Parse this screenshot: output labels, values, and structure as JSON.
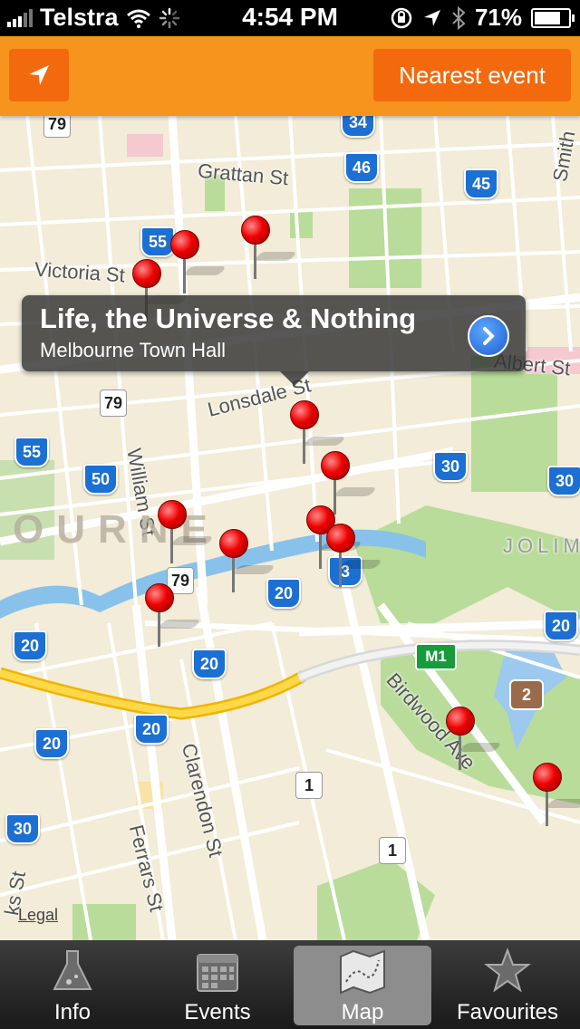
{
  "status_bar": {
    "carrier": "Telstra",
    "time": "4:54 PM",
    "battery_percent": "71%",
    "battery_level": 0.71
  },
  "toolbar": {
    "locate_icon": "location-arrow-icon",
    "nearest_label": "Nearest event"
  },
  "map": {
    "streets": [
      "Grattan St",
      "Victoria St",
      "Lonsdale St",
      "William St",
      "Albert St",
      "Smith",
      "Clarendon St",
      "Ferrars St",
      "Birdwood Ave",
      "ks St"
    ],
    "area_labels": [
      "OURNE",
      "JOLIM"
    ],
    "route_shields": [
      "79",
      "34",
      "46",
      "45",
      "55",
      "79",
      "55",
      "50",
      "30",
      "30",
      "79",
      "20",
      "20",
      "20",
      "20",
      "20",
      "20",
      "30",
      "M1",
      "2",
      "1",
      "1",
      "3"
    ],
    "legal": "Legal"
  },
  "callout": {
    "title": "Life, the Universe & Nothing",
    "subtitle": "Melbourne Town Hall",
    "icon": "disclosure-chevron-icon"
  },
  "tabs": [
    {
      "label": "Info",
      "icon": "flask-icon"
    },
    {
      "label": "Events",
      "icon": "calendar-icon"
    },
    {
      "label": "Map",
      "icon": "map-icon"
    },
    {
      "label": "Favourites",
      "icon": "star-icon"
    }
  ],
  "active_tab": "Map"
}
